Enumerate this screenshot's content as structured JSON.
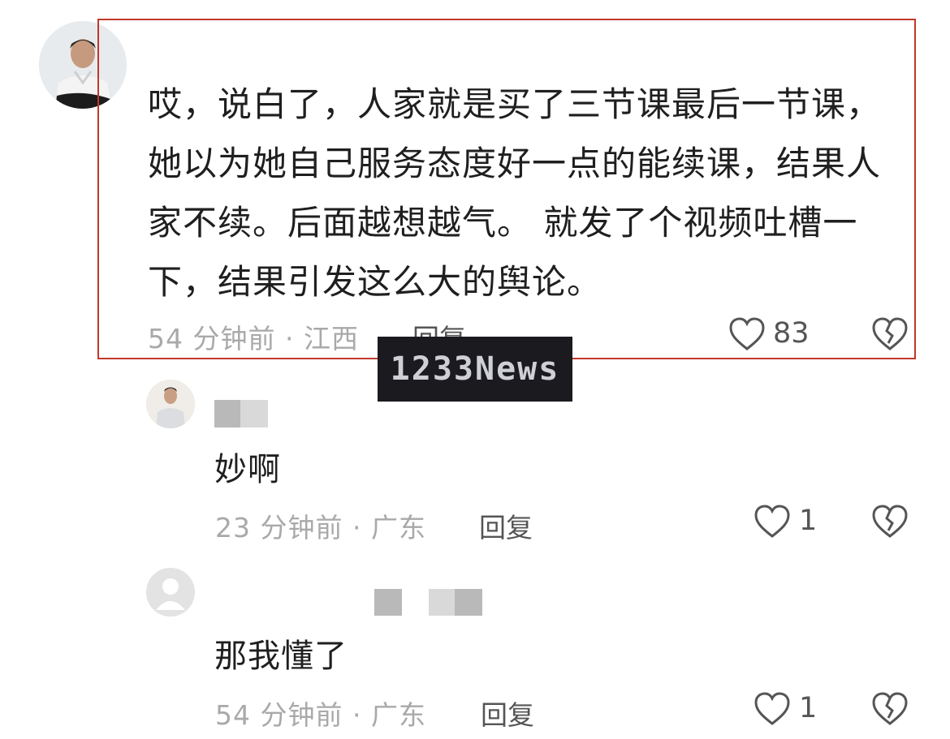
{
  "main_comment": {
    "text": "哎，说白了，人家就是买了三节课最后一节课，她以为她自己服务态度好一点的能续课，结果人家不续。后面越想越气。 就发了个视频吐槽一下，结果引发这么大的舆论。",
    "time_location": "54 分钟前 · 江西",
    "reply_label": "回复",
    "like_count": "83"
  },
  "watermark": {
    "text": "1233News"
  },
  "replies": [
    {
      "text": "妙啊",
      "time_location": "23 分钟前 · 广东",
      "reply_label": "回复",
      "like_count": "1"
    },
    {
      "text": "那我懂了",
      "time_location": "54 分钟前 · 广东",
      "reply_label": "回复",
      "like_count": "1"
    }
  ],
  "colors": {
    "highlight_border": "#c0392b",
    "watermark_bg": "#1a1a1f",
    "meta_text": "#a9a9a9"
  }
}
